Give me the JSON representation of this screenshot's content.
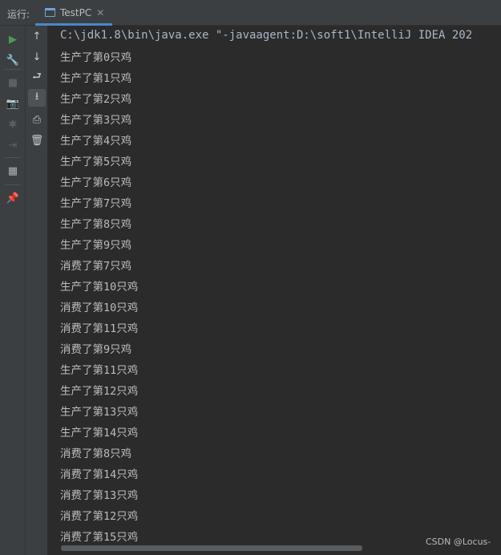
{
  "header": {
    "run_label": "运行:",
    "tab_label": "TestPC",
    "tab_close": "✕"
  },
  "left_toolbar": [
    {
      "name": "run-icon",
      "glyph": "▶",
      "color": "#499c54"
    },
    {
      "name": "wrench-icon",
      "glyph": "🔧",
      "color": "#afb1b3"
    },
    {
      "name": "stop-icon",
      "glyph": "■",
      "color": "#5c5f61"
    },
    {
      "name": "camera-icon",
      "glyph": "📷",
      "color": "#5c5f61"
    },
    {
      "name": "bug-icon",
      "glyph": "✱",
      "color": "#5c5f61"
    },
    {
      "name": "exit-icon",
      "glyph": "⇥",
      "color": "#5c5f61"
    },
    {
      "name": "layout-icon",
      "glyph": "▦",
      "color": "#afb1b3"
    },
    {
      "name": "pin-icon",
      "glyph": "📌",
      "color": "#afb1b3"
    }
  ],
  "console_toolbar": [
    {
      "name": "arrow-up-icon",
      "glyph": "↑"
    },
    {
      "name": "arrow-down-icon",
      "glyph": "↓"
    },
    {
      "name": "soft-wrap-icon",
      "glyph": "⮐"
    },
    {
      "name": "scroll-to-end-icon",
      "glyph": "⭳"
    },
    {
      "name": "print-icon",
      "glyph": "⎙"
    },
    {
      "name": "trash-icon",
      "glyph": "🗑"
    }
  ],
  "console": {
    "command": "C:\\jdk1.8\\bin\\java.exe \"-javaagent:D:\\soft1\\IntelliJ IDEA 202",
    "lines": [
      "生产了第0只鸡",
      "生产了第1只鸡",
      "生产了第2只鸡",
      "生产了第3只鸡",
      "生产了第4只鸡",
      "生产了第5只鸡",
      "生产了第6只鸡",
      "生产了第7只鸡",
      "生产了第8只鸡",
      "生产了第9只鸡",
      "消费了第7只鸡",
      "生产了第10只鸡",
      "消费了第10只鸡",
      "消费了第11只鸡",
      "消费了第9只鸡",
      "生产了第11只鸡",
      "生产了第12只鸡",
      "生产了第13只鸡",
      "生产了第14只鸡",
      "消费了第8只鸡",
      "消费了第14只鸡",
      "消费了第13只鸡",
      "消费了第12只鸡",
      "消费了第15只鸡"
    ]
  },
  "watermark": "CSDN @Locus-"
}
